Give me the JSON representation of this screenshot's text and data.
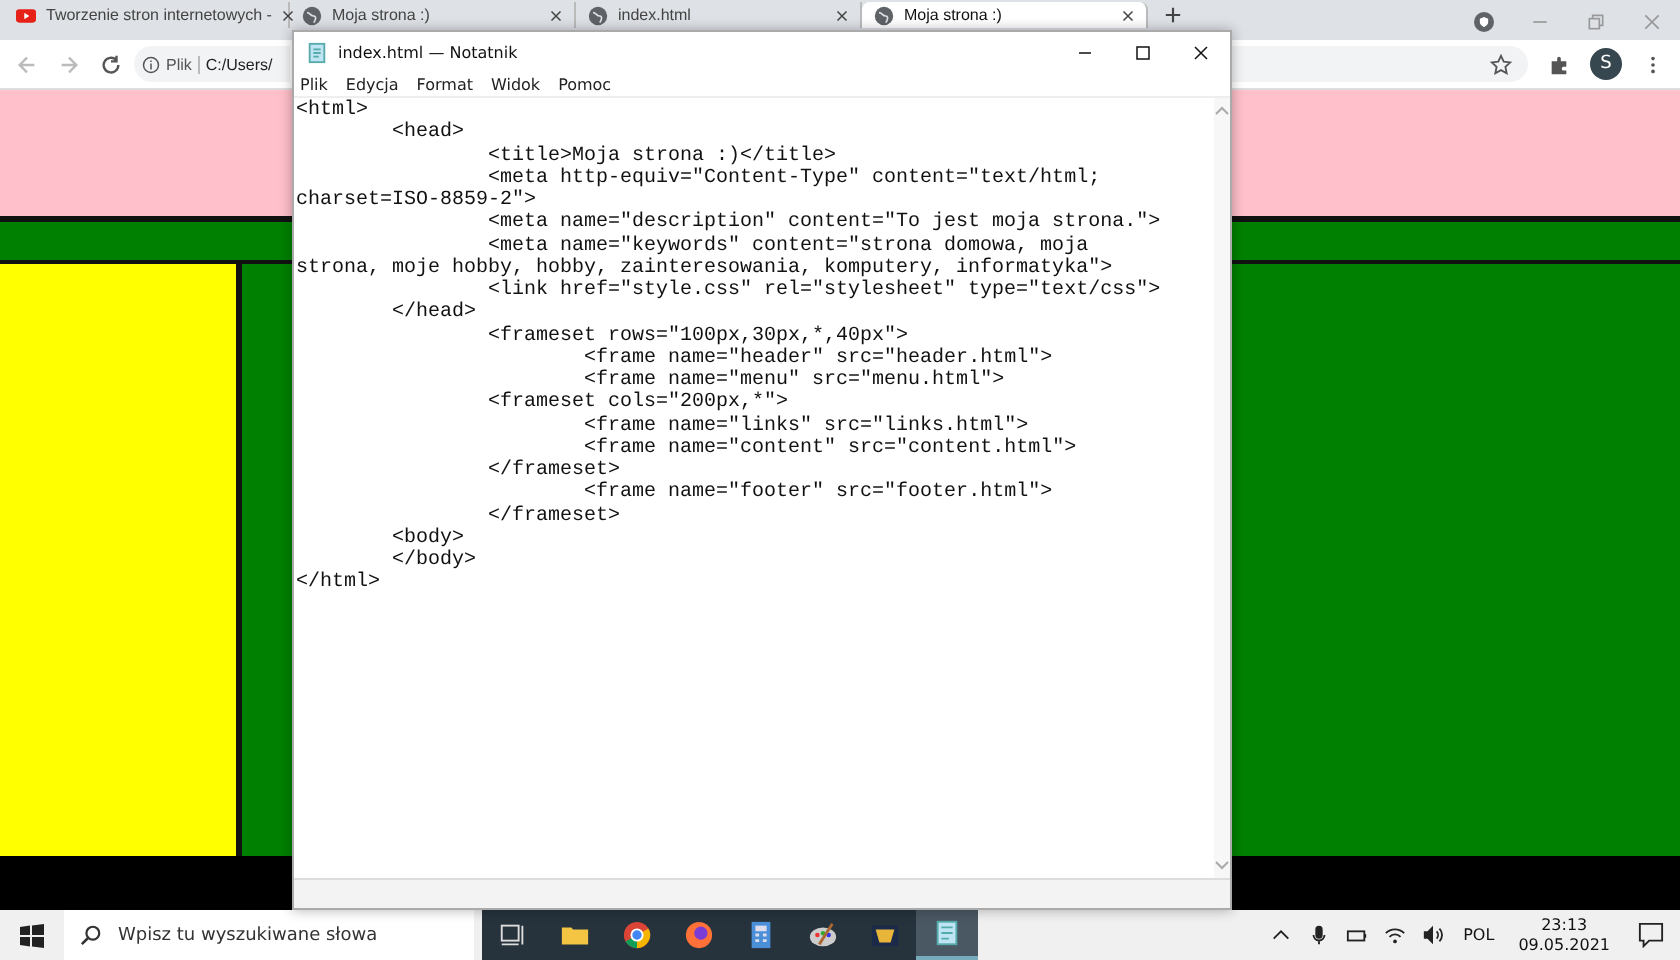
{
  "browser": {
    "tabs": [
      {
        "label": "Tworzenie stron internetowych -",
        "kind": "video",
        "selected": false
      },
      {
        "label": "Moja strona :)",
        "kind": "globe",
        "selected": false
      },
      {
        "label": "index.html",
        "kind": "globe",
        "selected": false
      },
      {
        "label": "Moja strona :)",
        "kind": "globe",
        "selected": true
      }
    ],
    "address": {
      "scheme": "Plik",
      "url": "C:/Users/"
    },
    "profile": "S"
  },
  "notepad": {
    "title": "index.html — Notatnik",
    "menu": [
      "Plik",
      "Edycja",
      "Format",
      "Widok",
      "Pomoc"
    ],
    "lines": [
      "<html>",
      "\t<head>",
      "\t\t<title>Moja strona :)</title>",
      "\t\t<meta http-equiv=\"Content-Type\" content=\"text/html;",
      "charset=ISO-8859-2\">",
      "\t\t<meta name=\"description\" content=\"To jest moja strona.\">",
      "\t\t<meta name=\"keywords\" content=\"strona domowa, moja",
      "strona, moje hobby, hobby, zainteresowania, komputery, informatyka\">",
      "\t\t<link href=\"style.css\" rel=\"stylesheet\" type=\"text/css\">",
      "\t</head>",
      "\t\t<frameset rows=\"100px,30px,*,40px\">",
      "\t\t\t<frame name=\"header\" src=\"header.html\">",
      "\t\t\t<frame name=\"menu\" src=\"menu.html\">",
      "\t\t<frameset cols=\"200px,*\">",
      "\t\t\t<frame name=\"links\" src=\"links.html\">",
      "\t\t\t<frame name=\"content\" src=\"content.html\">",
      "\t\t</frameset>",
      "\t\t\t<frame name=\"footer\" src=\"footer.html\">",
      "\t\t</frameset>",
      "\t<body>",
      "\t</body>",
      "</html>"
    ]
  },
  "taskbar": {
    "search_placeholder": "Wpisz tu wyszukiwane słowa",
    "apps": [
      {
        "kind": "taskview",
        "selected": false
      },
      {
        "kind": "folder",
        "selected": false
      },
      {
        "kind": "chrome",
        "selected": false
      },
      {
        "kind": "firefox",
        "selected": false
      },
      {
        "kind": "calculator",
        "selected": false
      },
      {
        "kind": "paint",
        "selected": false
      },
      {
        "kind": "game",
        "selected": false
      },
      {
        "kind": "notepad",
        "selected": true
      }
    ],
    "language": "POL",
    "time": "23:13",
    "date": "09.05.2021"
  }
}
